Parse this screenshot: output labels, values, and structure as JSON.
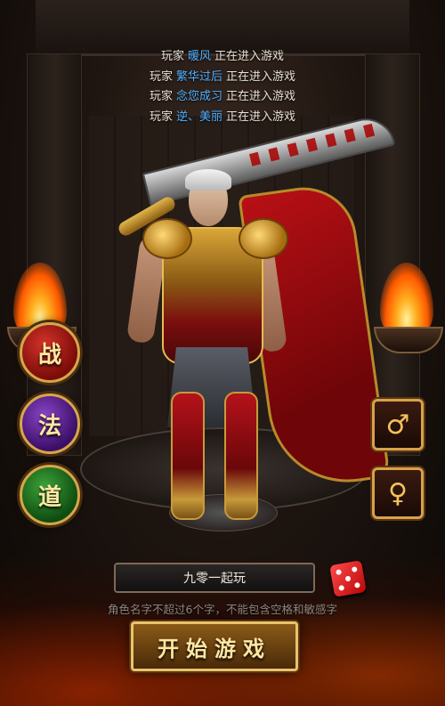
{
  "notices": [
    {
      "prefix": "玩家",
      "name": "暖风",
      "suffix": "正在进入游戏"
    },
    {
      "prefix": "玩家",
      "name": "繁华过后",
      "suffix": "正在进入游戏"
    },
    {
      "prefix": "玩家",
      "name": "念您成习",
      "suffix": "正在进入游戏"
    },
    {
      "prefix": "玩家",
      "name": "逆、美丽",
      "suffix": "正在进入游戏"
    }
  ],
  "classes": {
    "warrior": "战",
    "mage": "法",
    "taoist": "道"
  },
  "gender": {
    "male_symbol": "♂",
    "female_symbol": "♀"
  },
  "character": {
    "name_value": "九零一起玩",
    "hint": "角色名字不超过6个字，不能包含空格和敏感字"
  },
  "start_button": "开始游戏",
  "icons": {
    "dice": "dice-icon"
  },
  "colors": {
    "player_name": "#4fb0ff",
    "gold_border": "#d7a64a"
  }
}
